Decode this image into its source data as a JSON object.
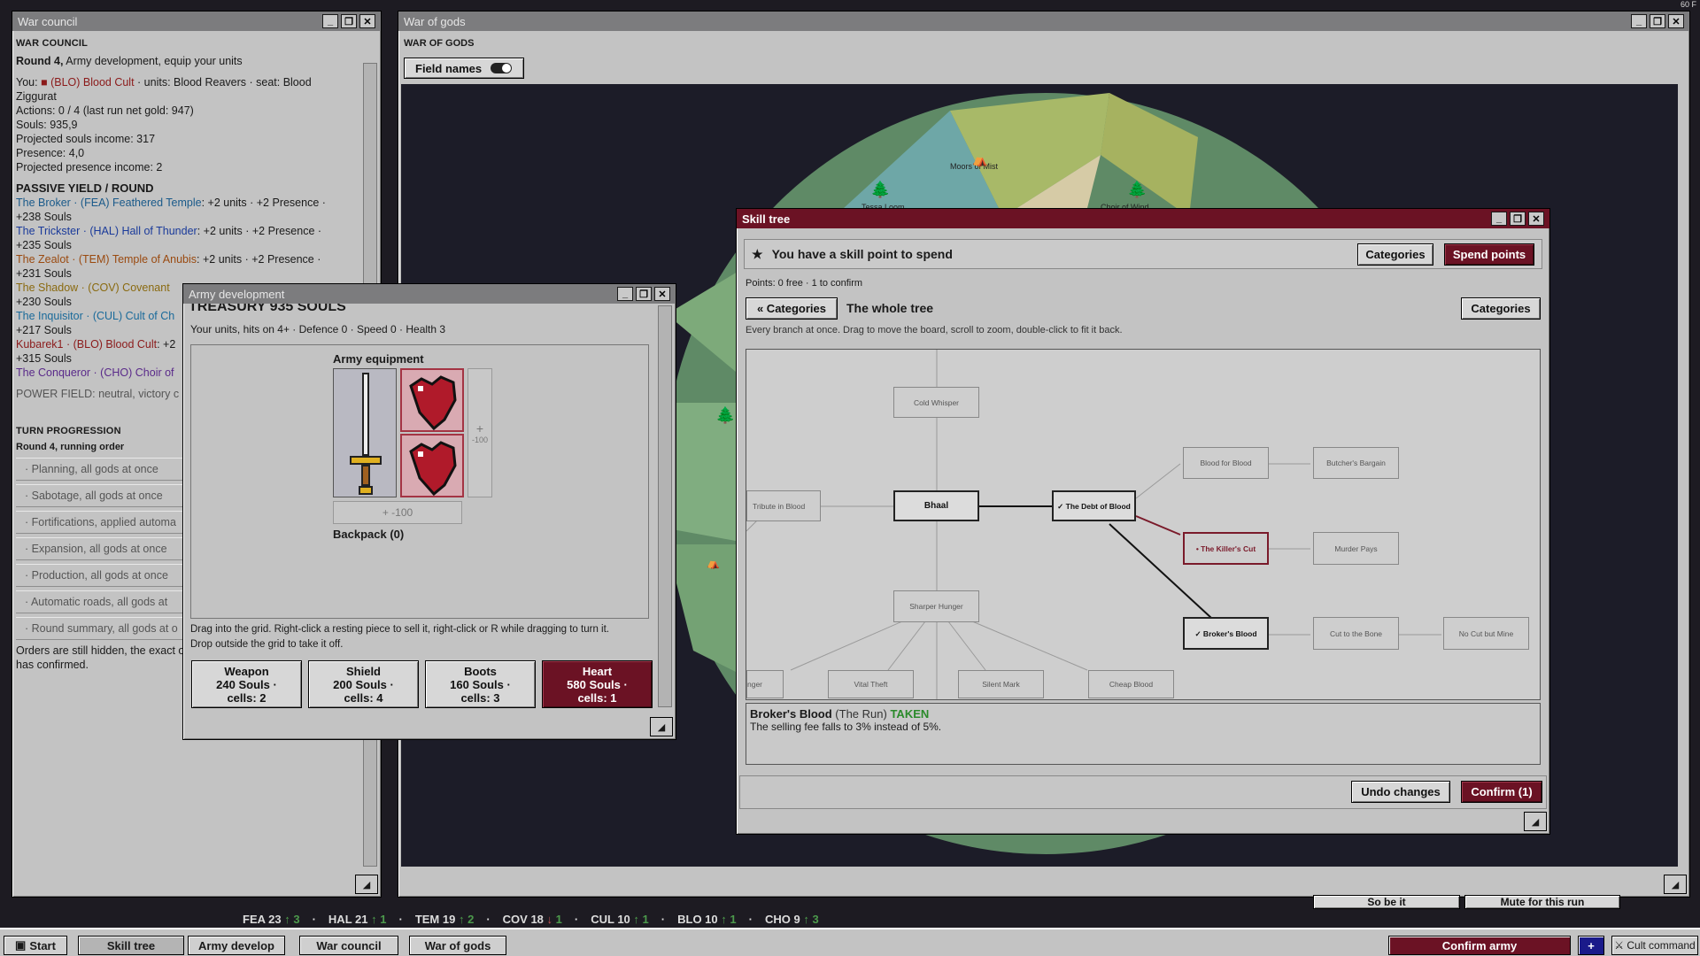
{
  "fps": "60 F",
  "war_council": {
    "title": "War council",
    "heading": "WAR COUNCIL",
    "round_bold": "Round 4,",
    "round_rest": " Army development, equip your units",
    "you_prefix": "You: ",
    "you_faction": "(BLO) Blood Cult",
    "you_rest": " · units: Blood Reavers · seat: Blood",
    "you_rest2": "Ziggurat",
    "actions": "Actions: 0 / 4 (last run net gold: 947)",
    "souls": "Souls: 935,9",
    "proj_souls": "Projected souls income: 317",
    "presence": "Presence: 4,0",
    "proj_presence": "Projected presence income: 2",
    "yield_h": "PASSIVE YIELD / ROUND",
    "yields": [
      {
        "faction": "The Broker · (FEA) Feathered Temple",
        "rest": ": +2 units · +2 Presence ·",
        "souls": "+238 Souls"
      },
      {
        "faction": "The Trickster · (HAL) Hall of Thunder",
        "rest": ": +2 units · +2 Presence ·",
        "souls": "+235 Souls"
      },
      {
        "faction": "The Zealot · (TEM) Temple of Anubis",
        "rest": ": +2 units · +2 Presence ·",
        "souls": "+231 Souls"
      },
      {
        "faction": "The Shadow · (COV) Covenant",
        "rest": "",
        "souls": "+230 Souls"
      },
      {
        "faction": "The Inquisitor · (CUL) Cult of Ch",
        "rest": "",
        "souls": "+217 Souls"
      },
      {
        "faction": "Kubarek1 · (BLO) Blood Cult",
        "rest": ": +2",
        "souls": "+315 Souls"
      },
      {
        "faction": "The Conqueror · (CHO) Choir of",
        "rest": "",
        "souls": ""
      }
    ],
    "power": "POWER FIELD: neutral, victory c",
    "turn_h": "TURN PROGRESSION",
    "turn_sub": "Round 4, running order",
    "phases": [
      "· Planning, all gods at once",
      "· Sabotage, all gods at once",
      "· Fortifications, applied automa",
      "· Expansion, all gods at once",
      "· Production, all gods at once",
      "· Automatic roads, all gods at",
      "· Round summary, all gods at o"
    ],
    "orders1": "Orders are still hidden, the exact or",
    "orders2": "has confirmed."
  },
  "war_of_gods": {
    "title": "War of gods",
    "heading": "WAR OF GODS",
    "field_names": "Field names",
    "map_labels": [
      "Moors of Mist",
      "Choir of Wind",
      "Tessa Loom"
    ],
    "bottom_btns": [
      "So be it",
      "Mute for this run"
    ]
  },
  "army": {
    "title": "Army development",
    "cut": "TREASURY 935 SOULS",
    "units": "Your units, hits on 4+ · Defence 0 · Speed 0 · Health 3",
    "equip": "Army equipment",
    "plus_a": "+",
    "cost_a": "-100",
    "plus_b": "+  -100",
    "backpack": "Backpack (0)",
    "hint": "Drag into the grid. Right-click a resting piece to sell it, right-click or R while dragging to turn it. Drop outside the grid to take it off.",
    "items": [
      {
        "name": "Weapon",
        "cost": "240 Souls ·",
        "cells": "cells: 2"
      },
      {
        "name": "Shield",
        "cost": "200 Souls ·",
        "cells": "cells: 4"
      },
      {
        "name": "Boots",
        "cost": "160 Souls ·",
        "cells": "cells: 3"
      },
      {
        "name": "Heart",
        "cost": "580 Souls ·",
        "cells": "cells: 1"
      }
    ]
  },
  "skill": {
    "title": "Skill tree",
    "star": "★",
    "banner": "You have a skill point to spend",
    "categories": "Categories",
    "spend": "Spend points",
    "points": "Points: 0 free  ·  1 to confirm",
    "back": "« Categories",
    "whole": "The whole tree",
    "categories2": "Categories",
    "hint": "Every branch at once. Drag to move the board, scroll to zoom, double-click to fit it back.",
    "nodes": {
      "cold": "Cold Whisper",
      "tribute": "Tribute in Blood",
      "bhaal": "Bhaal",
      "debt": "✓ The Debt of Blood",
      "bfb": "Blood for Blood",
      "butcher": "Butcher's Bargain",
      "killer": "• The Killer's Cut",
      "murder": "Murder Pays",
      "broker": "✓ Broker's Blood",
      "cut": "Cut to the Bone",
      "nocut": "No Cut but Mine",
      "sharper": "Sharper Hunger",
      "nger": "nger",
      "vital": "Vital Theft",
      "silent": "Silent Mark",
      "cheap": "Cheap Blood"
    },
    "detail_name": "Broker's Blood",
    "detail_cat": "(The Run)",
    "detail_status": "TAKEN",
    "detail_desc": "The selling fee falls to 3% instead of 5%.",
    "undo": "Undo changes",
    "confirm": "Confirm (1)"
  },
  "stats": [
    {
      "name": "FEA 23",
      "arrow": "↑",
      "d": "3",
      "dir": "up"
    },
    {
      "name": "HAL 21",
      "arrow": "↑",
      "d": "1",
      "dir": "up"
    },
    {
      "name": "TEM 19",
      "arrow": "↑",
      "d": "2",
      "dir": "up"
    },
    {
      "name": "COV 18",
      "arrow": "↓",
      "d": "1",
      "dir": "dn"
    },
    {
      "name": "CUL 10",
      "arrow": "↑",
      "d": "1",
      "dir": "up"
    },
    {
      "name": "BLO 10",
      "arrow": "↑",
      "d": "1",
      "dir": "up"
    },
    {
      "name": "CHO 9",
      "arrow": "↑",
      "d": "3",
      "dir": "up"
    }
  ],
  "taskbar": {
    "start": "Start",
    "tasks": [
      "Skill tree",
      "Army develop",
      "War council",
      "War of gods"
    ],
    "confirm_army": "Confirm army",
    "plus": "+",
    "cult": "⚔ Cult command"
  }
}
